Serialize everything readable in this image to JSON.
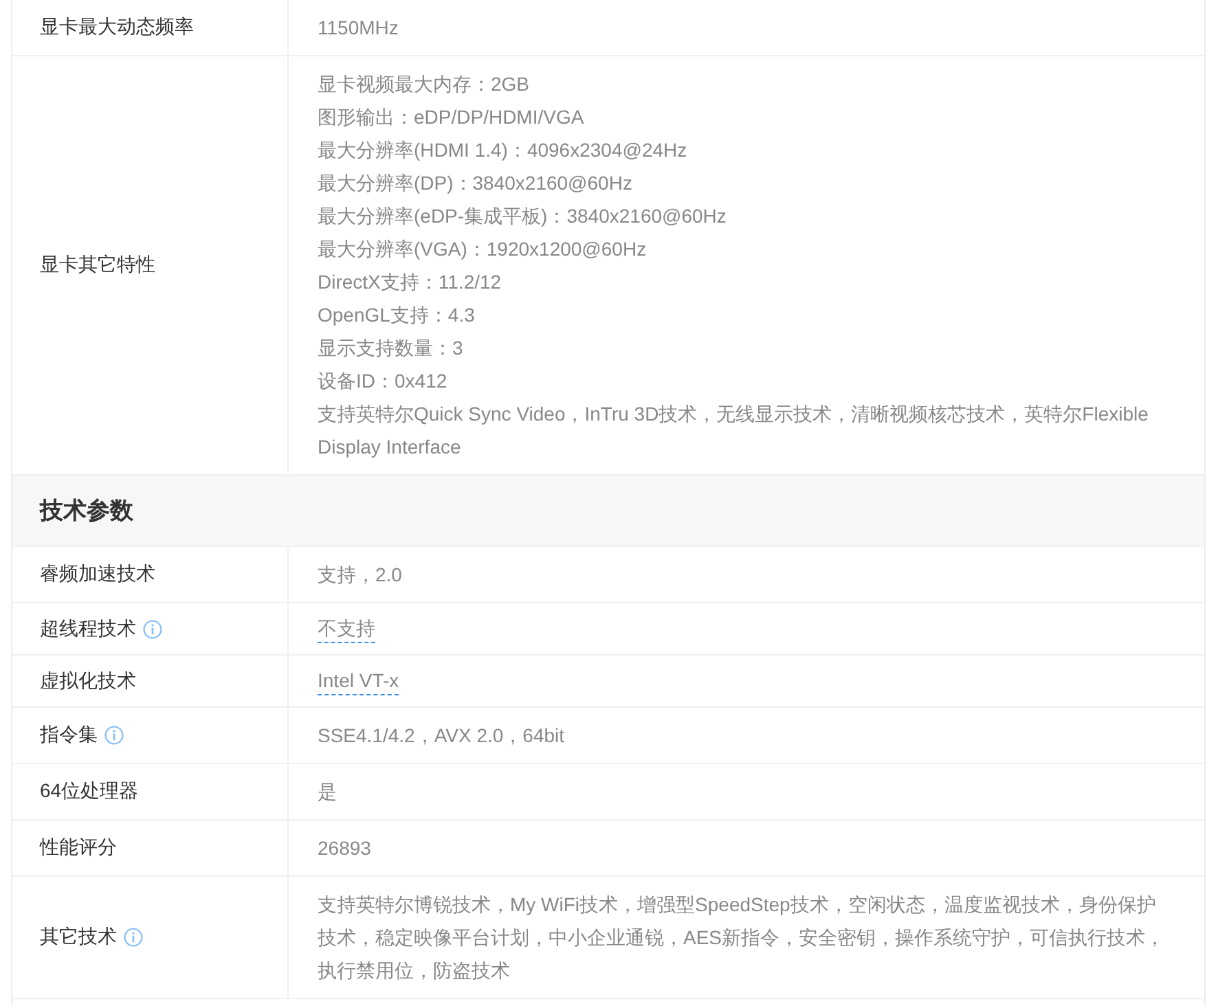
{
  "rows_before": [
    {
      "label": "显卡最大动态频率",
      "info": false,
      "values": [
        "1150MHz"
      ],
      "underlined": false
    },
    {
      "label": "显卡其它特性",
      "info": false,
      "values": [
        "显卡视频最大内存：2GB",
        "图形输出：eDP/DP/HDMI/VGA",
        "最大分辨率(HDMI 1.4)：4096x2304@24Hz",
        "最大分辨率(DP)：3840x2160@60Hz",
        "最大分辨率(eDP-集成平板)：3840x2160@60Hz",
        "最大分辨率(VGA)：1920x1200@60Hz",
        "DirectX支持：11.2/12",
        "OpenGL支持：4.3",
        "显示支持数量：3",
        "设备ID：0x412",
        "支持英特尔Quick Sync Video，InTru 3D技术，无线显示技术，清晰视频核芯技术，英特尔Flexible Display Interface"
      ],
      "underlined": false
    }
  ],
  "section": {
    "title": "技术参数",
    "rows": [
      {
        "label": "睿频加速技术",
        "info": false,
        "values": [
          "支持，2.0"
        ],
        "underlined": false
      },
      {
        "label": "超线程技术",
        "info": true,
        "values": [
          "不支持"
        ],
        "underlined": true
      },
      {
        "label": "虚拟化技术",
        "info": false,
        "values": [
          "Intel VT-x"
        ],
        "underlined": true
      },
      {
        "label": "指令集",
        "info": true,
        "values": [
          "SSE4.1/4.2，AVX 2.0，64bit"
        ],
        "underlined": false
      },
      {
        "label": "64位处理器",
        "info": false,
        "values": [
          "是"
        ],
        "underlined": false
      },
      {
        "label": "性能评分",
        "info": false,
        "values": [
          "26893"
        ],
        "underlined": false
      },
      {
        "label": "其它技术",
        "info": true,
        "values": [
          "支持英特尔博锐技术，My WiFi技术，增强型SpeedStep技术，空闲状态，温度监视技术，身份保护技术，稳定映像平台计划，中小企业通锐，AES新指令，安全密钥，操作系统守护，可信执行技术，执行禁用位，防盗技术"
        ],
        "underlined": false
      }
    ]
  }
}
